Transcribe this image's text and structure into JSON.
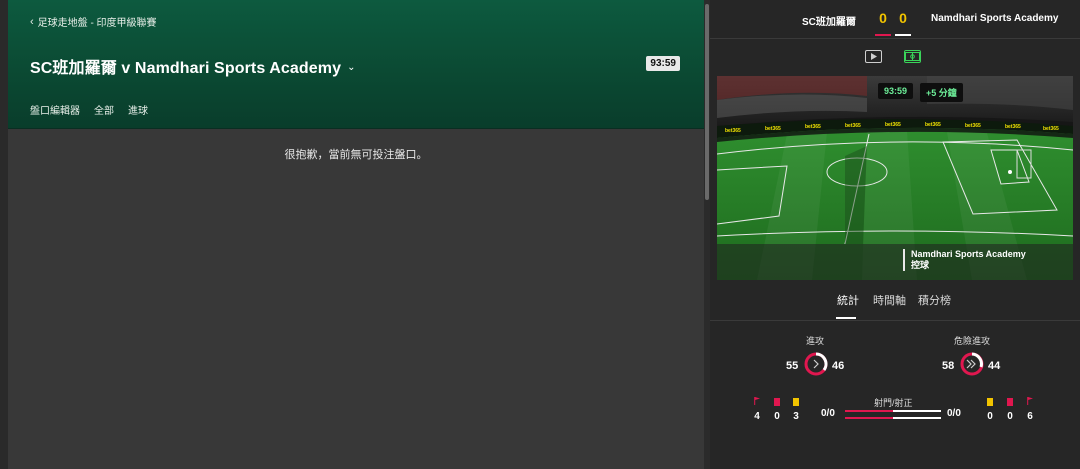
{
  "breadcrumb": {
    "text": "足球走地盤 - 印度甲級聯賽"
  },
  "match": {
    "title": "SC班加羅爾 v Namdhari Sports Academy",
    "clock": "93:59"
  },
  "market_tabs": [
    "盤口編輯器",
    "全部",
    "進球"
  ],
  "notice": "很抱歉，當前無可投注盤口。",
  "scoreboard": {
    "home_team": "SC班加羅爾",
    "away_team": "Namdhari Sports Academy",
    "home_score": "0",
    "away_score": "0"
  },
  "pitch": {
    "clock": "93:59",
    "added_time": "+5 分鐘",
    "possession_team": "Namdhari Sports Academy",
    "possession_label": "控球",
    "board_text": "bet365"
  },
  "stats_tabs": [
    "統計",
    "時間軸",
    "積分榜"
  ],
  "stats": {
    "attacks": {
      "label": "進攻",
      "home": "55",
      "away": "46"
    },
    "dangerous": {
      "label": "危險進攻",
      "home": "58",
      "away": "44"
    },
    "shots": {
      "label": "射門/射正",
      "home": "0/0",
      "away": "0/0"
    },
    "home_counts": {
      "corners": "4",
      "red_cards": "0",
      "yellow_cards": "3"
    },
    "away_counts": {
      "yellow_cards": "0",
      "red_cards": "0",
      "corners": "6"
    }
  },
  "colors": {
    "accent_pink": "#e0174f",
    "score_yellow": "#f2c400",
    "live_green": "#6ef09a",
    "hero_green": "#0b4a33"
  }
}
